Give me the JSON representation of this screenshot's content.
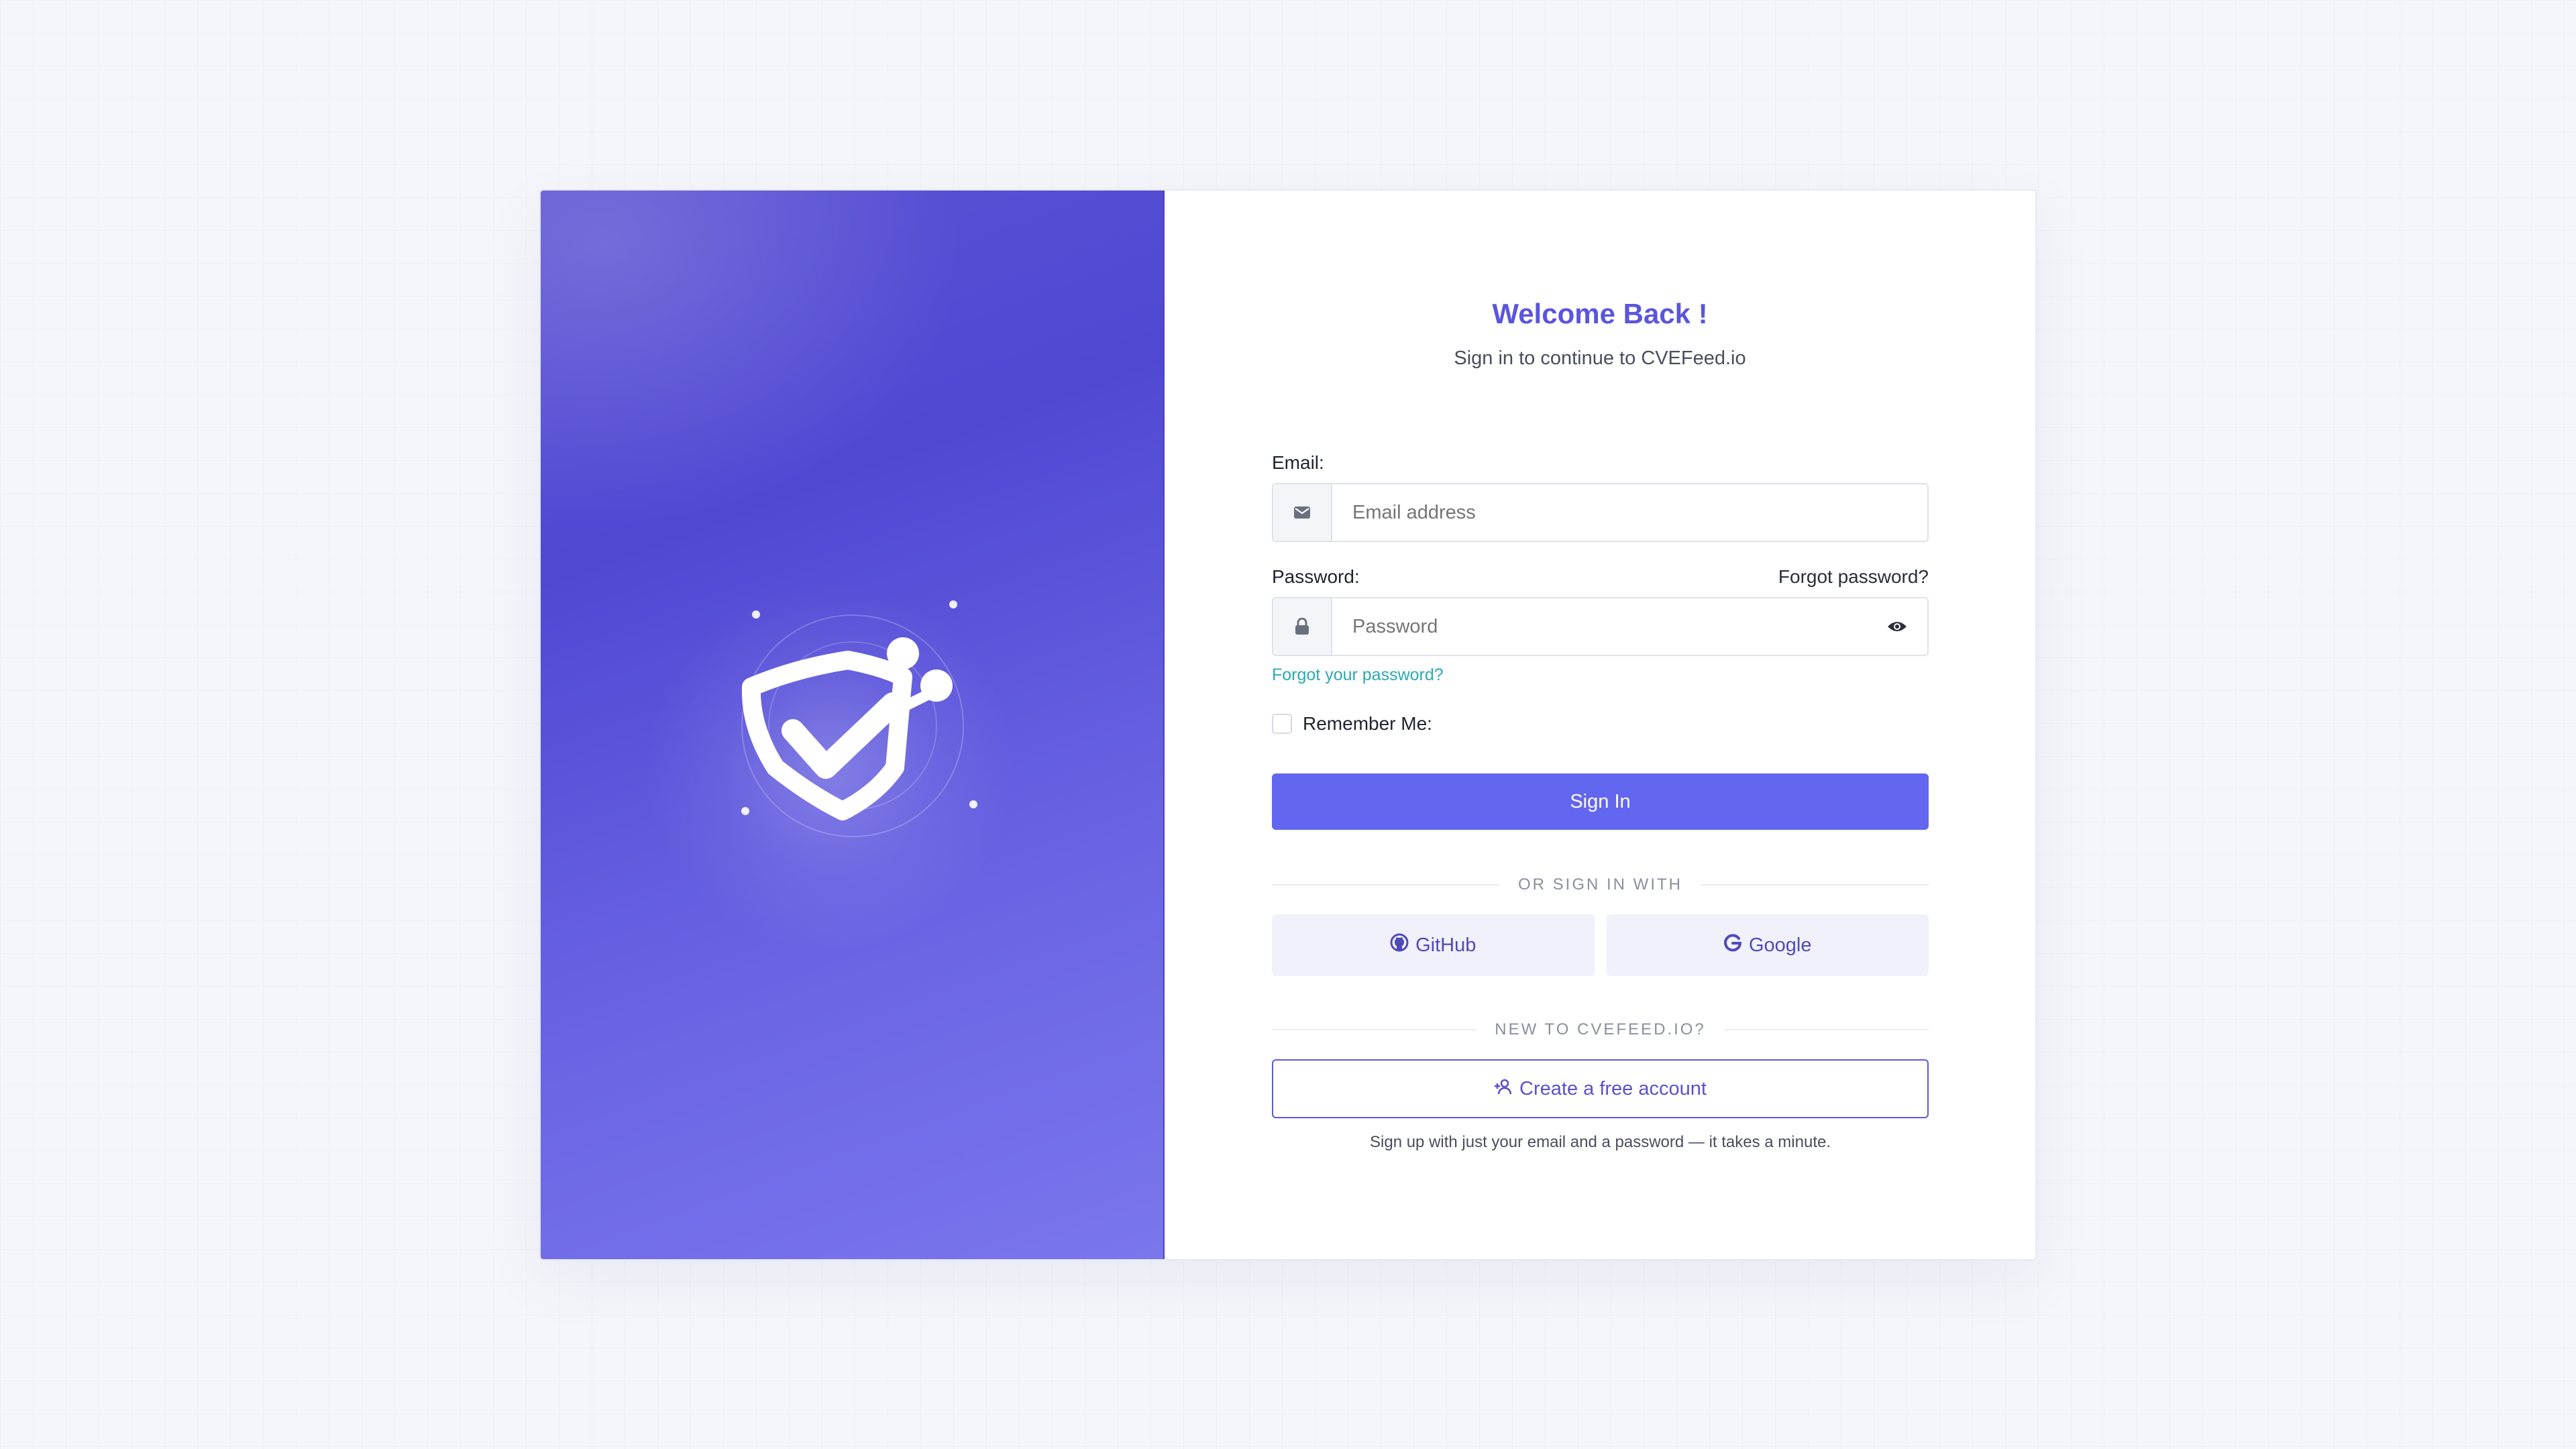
{
  "brand": {
    "accent": "#6366ee",
    "hero_color": "#5a52d3",
    "link_color": "#29aab3"
  },
  "hero": {
    "icon": "shield-check-icon"
  },
  "header": {
    "title": "Welcome Back !",
    "subtitle": "Sign in to continue to CVEFeed.io"
  },
  "form": {
    "email_label": "Email:",
    "email_placeholder": "Email address",
    "email_icon": "envelope-icon",
    "password_label": "Password:",
    "password_placeholder": "Password",
    "password_icon": "lock-icon",
    "show_password_icon": "eye-icon",
    "forgot_top": "Forgot password?",
    "forgot_link": "Forgot your password?",
    "remember_label": "Remember Me:",
    "remember_checked": false,
    "signin_label": "Sign In"
  },
  "social": {
    "divider": "OR SIGN IN WITH",
    "github_label": "GitHub",
    "google_label": "Google"
  },
  "signup": {
    "divider": "NEW TO CVEFEED.IO?",
    "button_label": "Create a free account",
    "hint": "Sign up with just your email and a password — it takes a minute."
  }
}
